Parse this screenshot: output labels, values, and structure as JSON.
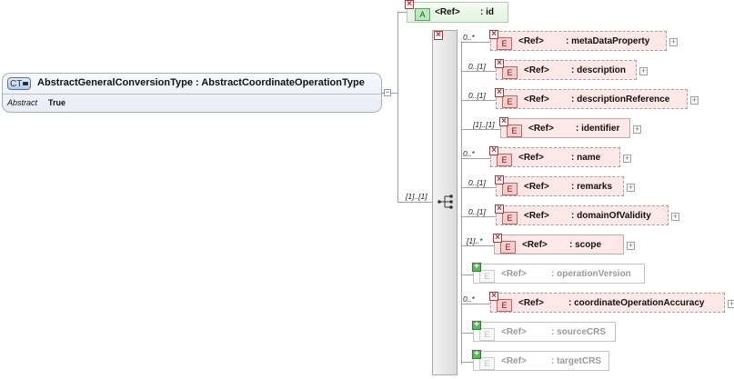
{
  "complex_type": {
    "badge": "CT",
    "name": "AbstractGeneralConversionType",
    "base": ": AbstractCoordinateOperationType",
    "attr_name": "Abstract",
    "attr_value": "True"
  },
  "attribute": {
    "badge": "A",
    "ref": "<Ref>",
    "name": ": id"
  },
  "sequence_multiplicity": "[1]..[1]",
  "ref_label": "<Ref>",
  "elements": [
    {
      "mult": "0..*",
      "name": ": metaDataProperty"
    },
    {
      "mult": "0..[1]",
      "name": ": description"
    },
    {
      "mult": "0..[1]",
      "name": ": descriptionReference"
    },
    {
      "mult": "[1]..[1]",
      "name": ": identifier"
    },
    {
      "mult": "0..*",
      "name": ": name"
    },
    {
      "mult": "0..[1]",
      "name": ": remarks"
    },
    {
      "mult": "0..[1]",
      "name": ": domainOfValidity"
    },
    {
      "mult": "[1]..*",
      "name": ": scope"
    },
    {
      "mult": "",
      "name": ": operationVersion"
    },
    {
      "mult": "0..*",
      "name": ": coordinateOperationAccuracy"
    },
    {
      "mult": "",
      "name": ": sourceCRS"
    },
    {
      "mult": "",
      "name": ": targetCRS"
    }
  ],
  "element_badge": "E"
}
